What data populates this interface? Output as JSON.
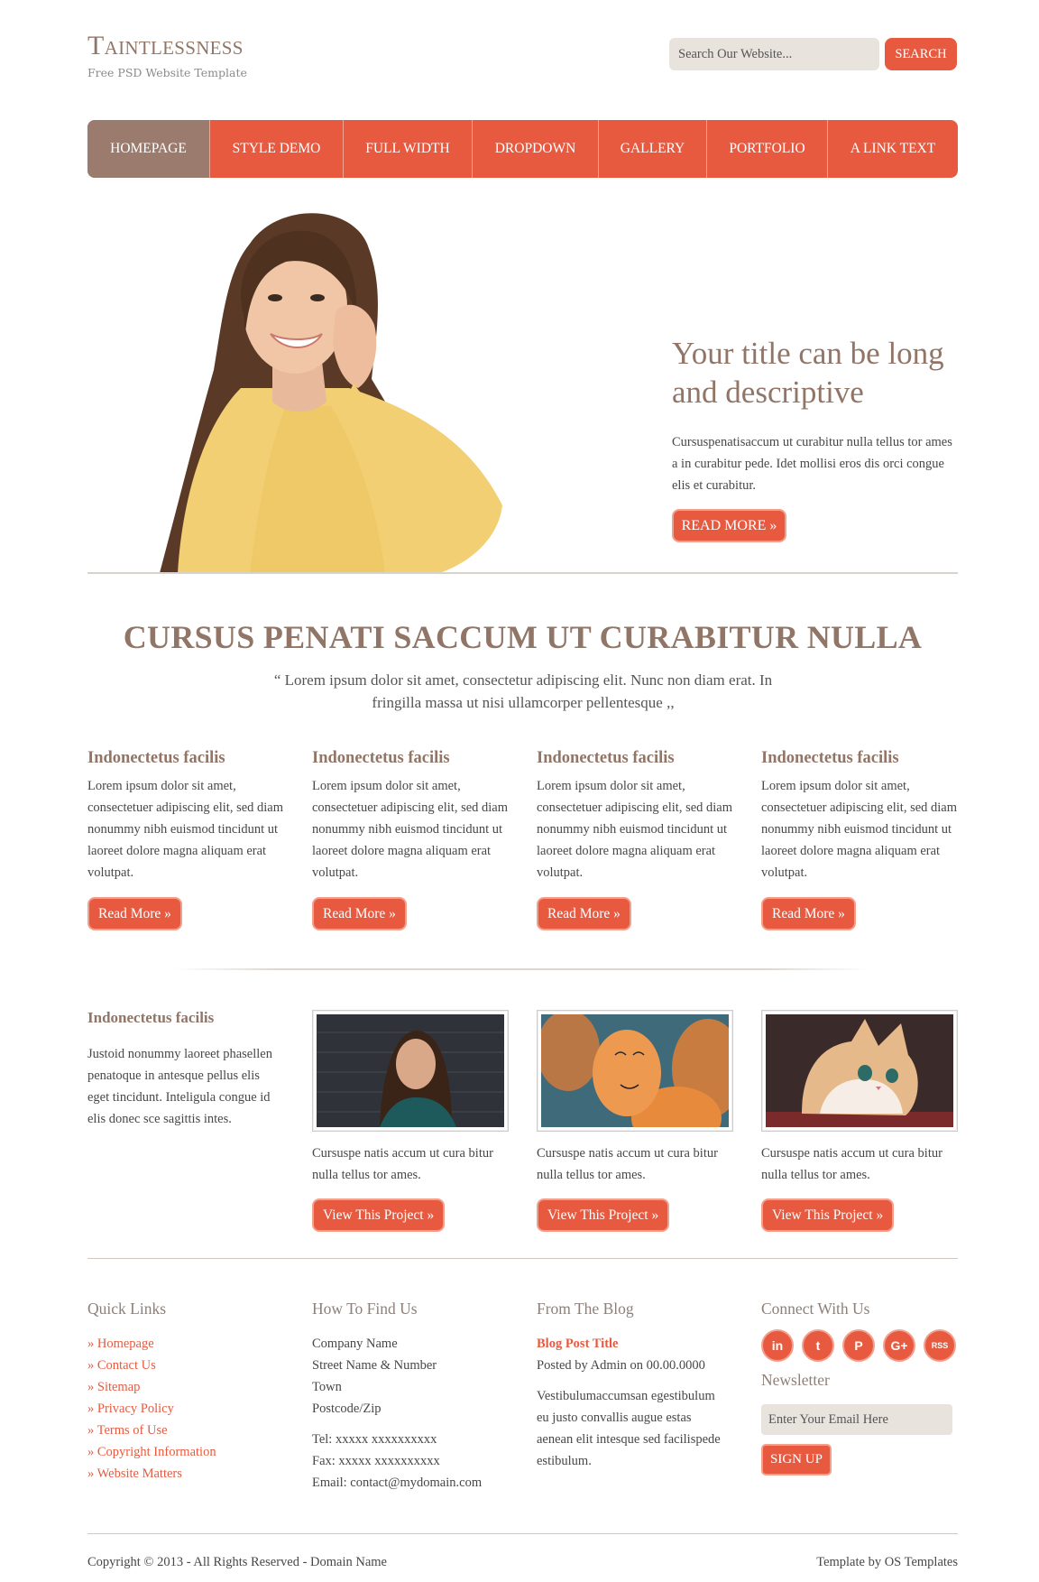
{
  "header": {
    "title": "Taintlessness",
    "tagline": "Free PSD Website Template",
    "search_placeholder": "Search Our Website...",
    "search_label": "SEARCH"
  },
  "nav": {
    "items": [
      {
        "label": "HOMEPAGE",
        "active": true
      },
      {
        "label": "STYLE DEMO"
      },
      {
        "label": "FULL WIDTH"
      },
      {
        "label": "DROPDOWN"
      },
      {
        "label": "GALLERY"
      },
      {
        "label": "PORTFOLIO"
      },
      {
        "label": "A LINK TEXT"
      }
    ]
  },
  "hero": {
    "title": "Your title can be long and descriptive",
    "text": "Cursuspenatisaccum ut curabitur nulla tellus tor ames a in curabitur pede. Idet mollisi eros dis orci congue elis et curabitur.",
    "button": "READ MORE »"
  },
  "intro": {
    "heading": "CURSUS PENATI SACCUM UT CURABITUR NULLA",
    "quote": "“ Lorem ipsum dolor sit amet, consectetur adipiscing elit. Nunc non diam erat. In fringilla massa ut nisi ullamcorper pellentesque ,,"
  },
  "features": [
    {
      "title": "Indonectetus facilis",
      "text": "Lorem ipsum dolor sit amet, consectetuer adipiscing elit, sed diam nonummy nibh euismod tincidunt ut laoreet dolore magna aliquam erat volutpat.",
      "button": "Read More »"
    },
    {
      "title": "Indonectetus facilis",
      "text": "Lorem ipsum dolor sit amet, consectetuer adipiscing elit, sed diam nonummy nibh euismod tincidunt ut laoreet dolore magna aliquam erat volutpat.",
      "button": "Read More »"
    },
    {
      "title": "Indonectetus facilis",
      "text": "Lorem ipsum dolor sit amet, consectetuer adipiscing elit, sed diam nonummy nibh euismod tincidunt ut laoreet dolore magna aliquam erat volutpat.",
      "button": "Read More »"
    },
    {
      "title": "Indonectetus facilis",
      "text": "Lorem ipsum dolor sit amet, consectetuer adipiscing elit, sed diam nonummy nibh euismod tincidunt ut laoreet dolore magna aliquam erat volutpat.",
      "button": "Read More »"
    }
  ],
  "projects": {
    "intro_title": "Indonectetus facilis",
    "intro_text": "Justoid nonummy laoreet phasellen penatoque in antesque pellus elis eget tincidunt. Inteligula congue id elis donec sce sagittis intes.",
    "items": [
      {
        "caption": "Cursuspe natis accum ut cura bitur nulla tellus tor ames.",
        "button": "View This Project »"
      },
      {
        "caption": "Cursuspe natis accum ut cura bitur nulla tellus tor ames.",
        "button": "View This Project »"
      },
      {
        "caption": "Cursuspe natis accum ut cura bitur nulla tellus tor ames.",
        "button": "View This Project »"
      }
    ]
  },
  "footer": {
    "quick_links": {
      "title": "Quick Links",
      "links": [
        "» Homepage",
        "» Contact Us",
        "» Sitemap",
        "» Privacy Policy",
        "» Terms of Use",
        "» Copyright Information",
        "» Website Matters"
      ]
    },
    "find_us": {
      "title": "How To Find Us",
      "address": [
        "Company Name",
        "Street Name & Number",
        "Town",
        "Postcode/Zip"
      ],
      "contact": [
        "Tel: xxxxx xxxxxxxxxx",
        "Fax: xxxxx xxxxxxxxxx",
        "Email: contact@mydomain.com"
      ]
    },
    "blog": {
      "title": "From The Blog",
      "post_title": "Blog Post Title",
      "post_meta": "Posted by Admin on 00.00.0000",
      "post_excerpt": "Vestibulumaccumsan egestibulum eu justo convallis augue estas aenean elit intesque sed facilispede estibulum."
    },
    "connect": {
      "title": "Connect With Us",
      "social": [
        {
          "icon": "linkedin-icon",
          "glyph": "in"
        },
        {
          "icon": "twitter-icon",
          "glyph": "t"
        },
        {
          "icon": "pinterest-icon",
          "glyph": "P"
        },
        {
          "icon": "google-plus-icon",
          "glyph": "G+"
        },
        {
          "icon": "rss-icon",
          "glyph": "RSS"
        }
      ],
      "newsletter_title": "Newsletter",
      "newsletter_placeholder": "Enter Your Email Here",
      "signup_label": "SIGN UP"
    },
    "copyright": "Copyright © 2013 - All Rights Reserved - Domain Name",
    "credit": "Template by OS Templates"
  },
  "colors": {
    "accent": "#e75a40",
    "brown": "#917566",
    "nav_active": "#9b7b6d"
  }
}
